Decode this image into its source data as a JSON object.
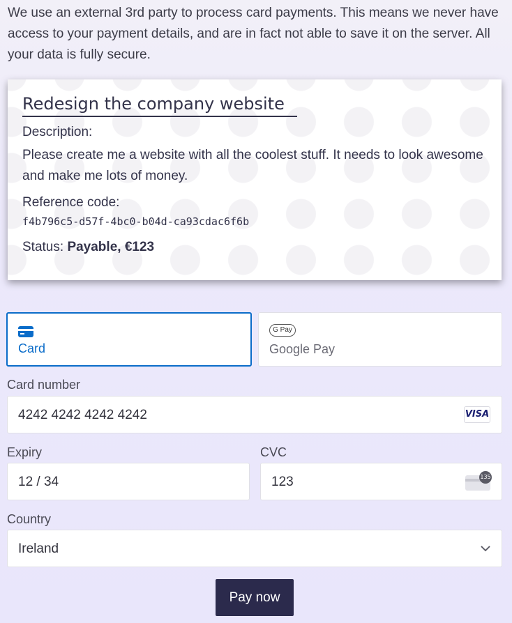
{
  "notice": "We use an external 3rd party to process card payments. This means we never have access to your payment details, and are in fact not able to save it on the server. All your data is fully secure.",
  "job": {
    "title": "Redesign the company website",
    "description_label": "Description:",
    "description": "Please create me a website with all the coolest stuff. It needs to look awesome and make me lots of money.",
    "reference_label": "Reference code:",
    "reference_code": "f4b796c5-d57f-4bc0-b04d-ca93cdac6f6b",
    "status_label": "Status:",
    "status_value": "Payable, €123"
  },
  "payment_methods": {
    "card_label": "Card",
    "gpay_label": "Google Pay",
    "gpay_badge": "G Pay",
    "active": "card"
  },
  "form": {
    "card_number_label": "Card number",
    "card_number_value": "4242 4242 4242 4242",
    "card_brand": "VISA",
    "expiry_label": "Expiry",
    "expiry_value": "12 / 34",
    "cvc_label": "CVC",
    "cvc_value": "123",
    "cvc_icon_text": "135",
    "country_label": "Country",
    "country_value": "Ireland"
  },
  "pay_button": "Pay now",
  "colors": {
    "accent": "#0a6cc9",
    "button": "#2b2a4c",
    "visa": "#1a1f71"
  }
}
